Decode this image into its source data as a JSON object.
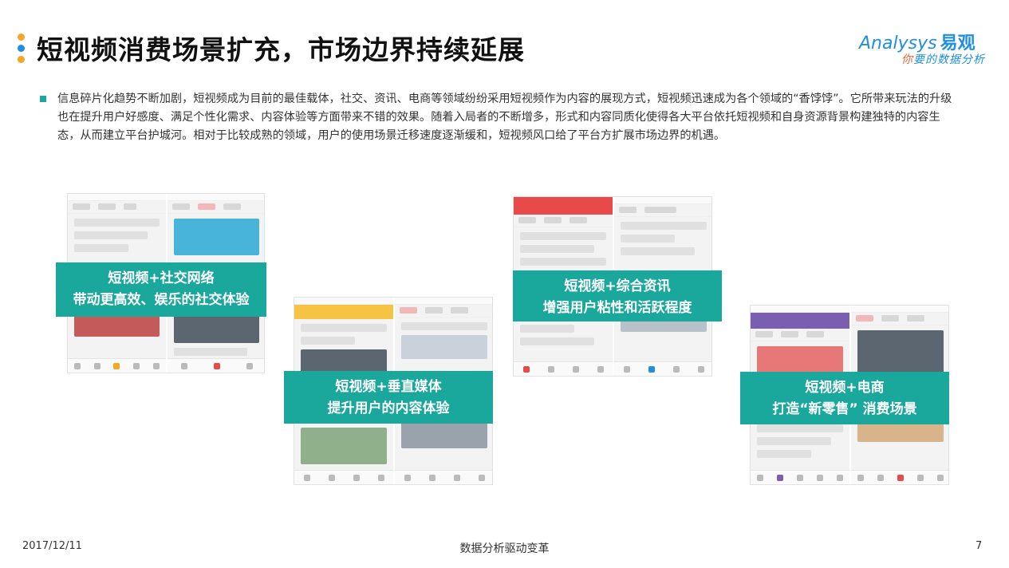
{
  "title": "短视频消费场景扩充，市场边界持续延展",
  "logo": {
    "brand_latin": "Analysys",
    "brand_cn": "易观",
    "slogan_em": "你",
    "slogan_rest": "要的数据分析"
  },
  "paragraph": "信息碎片化趋势不断加剧，短视频成为目前的最佳载体，社交、资讯、电商等领域纷纷采用短视频作为内容的展现方式，短视频迅速成为各个领域的“香饽饽”。它所带来玩法的升级也在提升用户好感度、满足个性化需求、内容体验等方面带来不错的效果。随着入局者的不断增多，形式和内容同质化使得各大平台依托短视频和自身资源背景构建独特的内容生态，从而建立平台护城河。相对于比较成熟的领域，用户的使用场景迁移速度逐渐缓和，短视频风口给了平台方扩展市场边界的机遇。",
  "captions": [
    {
      "line1": "短视频+社交网络",
      "line2": "带动更高效、娱乐的社交体验"
    },
    {
      "line1": "短视频+垂直媒体",
      "line2": "提升用户的内容体验"
    },
    {
      "line1": "短视频+综合资讯",
      "line2": "增强用户粘性和活跃程度"
    },
    {
      "line1": "短视频+电商",
      "line2": "打造“新零售” 消费场景"
    }
  ],
  "footer": {
    "date": "2017/12/11",
    "center": "数据分析驱动变革",
    "page": "7"
  },
  "colors": {
    "accent": "#1aa79c",
    "brand": "#1f8fe0",
    "dot_orange": "#f5a623"
  }
}
